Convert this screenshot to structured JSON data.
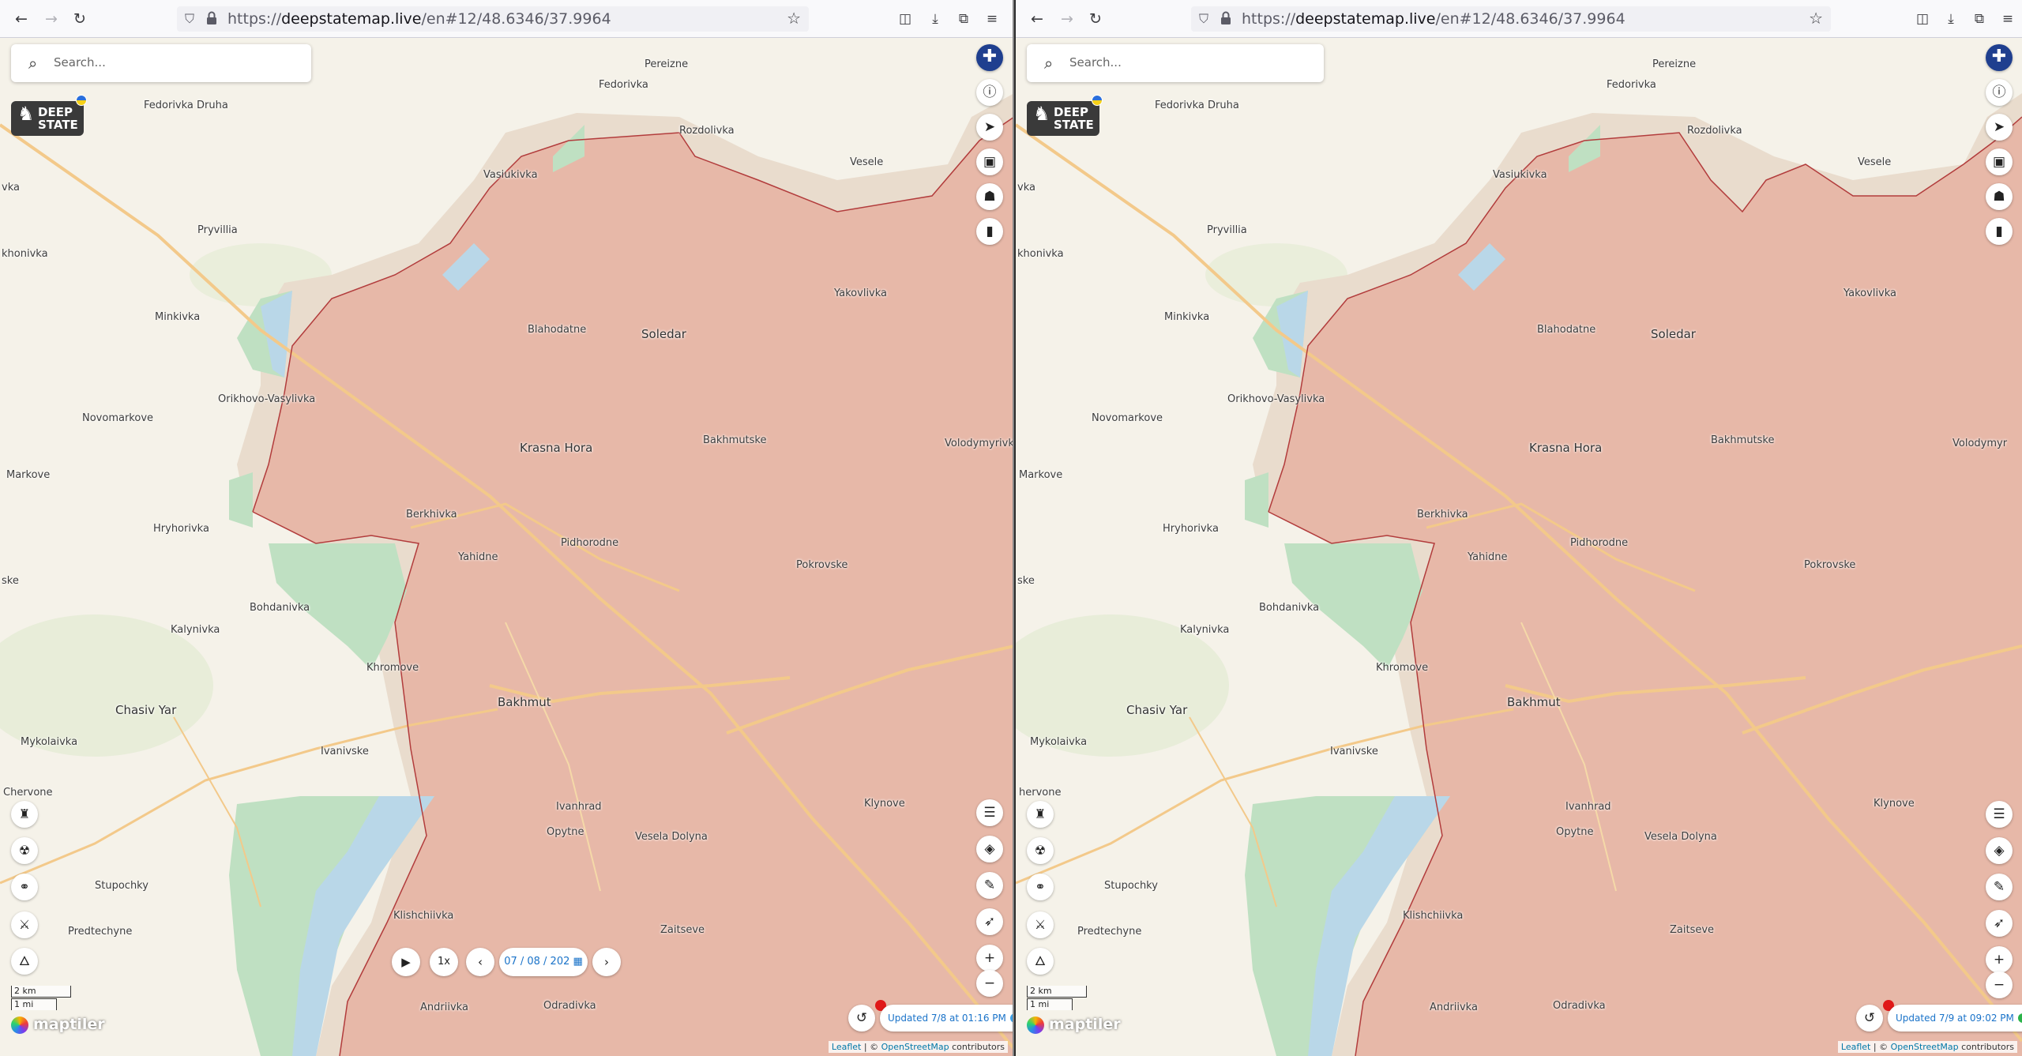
{
  "browser": {
    "url_prefix": "https://",
    "url_domain": "deepstatemap.live",
    "url_path": "/en#12/48.6346/37.9964"
  },
  "map": {
    "search_placeholder": "Search...",
    "logo_text": [
      "DEEP",
      "STATE"
    ],
    "places": {
      "pereizne": "Pereizne",
      "fedorivka": "Fedorivka",
      "fedorivka_druha": "Fedorivka Druha",
      "rozdolivka": "Rozdolivka",
      "vesele": "Vesele",
      "vasiukivka": "Vasiukivka",
      "pryvillia": "Pryvillia",
      "minkivka": "Minkivka",
      "blahodatne": "Blahodatne",
      "soledar": "Soledar",
      "yakovlivka": "Yakovlivka",
      "orikhovo_vasylivka": "Orikhovo-Vasylivka",
      "novomarkove": "Novomarkove",
      "krasna_hora": "Krasna Hora",
      "bakhmutske": "Bakhmutske",
      "volodymyrivka": "Volodymyrivka",
      "markove": "Markove",
      "berkhivka": "Berkhivka",
      "hryhorivka": "Hryhorivka",
      "yahidne": "Yahidne",
      "pidhorodne": "Pidhorodne",
      "pokrovske": "Pokrovske",
      "bohdanivka": "Bohdanivka",
      "kalynivka": "Kalynivka",
      "khromove": "Khromove",
      "chasiv_yar": "Chasiv Yar",
      "bakhmut": "Bakhmut",
      "mykolaivka": "Mykolaivka",
      "ivanivske": "Ivanivske",
      "chervone_left": "Chervone",
      "chervone_right": "hervone",
      "ivanhrad": "Ivanhrad",
      "klynove": "Klynove",
      "opytne": "Opytne",
      "vesela_dolyna": "Vesela Dolyna",
      "stupochky": "Stupochky",
      "klishchiivka": "Klishchiivka",
      "predtechyne": "Predtechyne",
      "zaitseve": "Zaitseve",
      "andriivka": "Andriivka",
      "odradivka": "Odradivka",
      "edge_vka": "vka",
      "edge_khonivka": "khonivka",
      "edge_ske": "ske",
      "edge_volodymyr_right": "Volodymyr"
    },
    "scale_km": "2 km",
    "scale_mi": "1 mi",
    "maptiler": "maptiler",
    "attribution_leaflet": "Leaflet",
    "attribution_sep": " | © ",
    "attribution_osm": "OpenStreetMap",
    "attribution_tail": " contributors",
    "zoom_in": "+",
    "zoom_out": "−"
  },
  "left": {
    "updated_text": "Updated 7/8 at 01:16 PM",
    "status_color": "#3aa0e8",
    "playback": {
      "speed": "1x",
      "date": "07 / 08 / 202"
    }
  },
  "right": {
    "updated_text": "Updated 7/9 at 09:02 PM",
    "status_color": "#2bb34a"
  },
  "colors": {
    "occupied": "#e7b8a8",
    "contested": "#e9dccd",
    "liberated": "#bfe0c2",
    "water": "#b9d7e8",
    "road": "#f3c98a"
  }
}
